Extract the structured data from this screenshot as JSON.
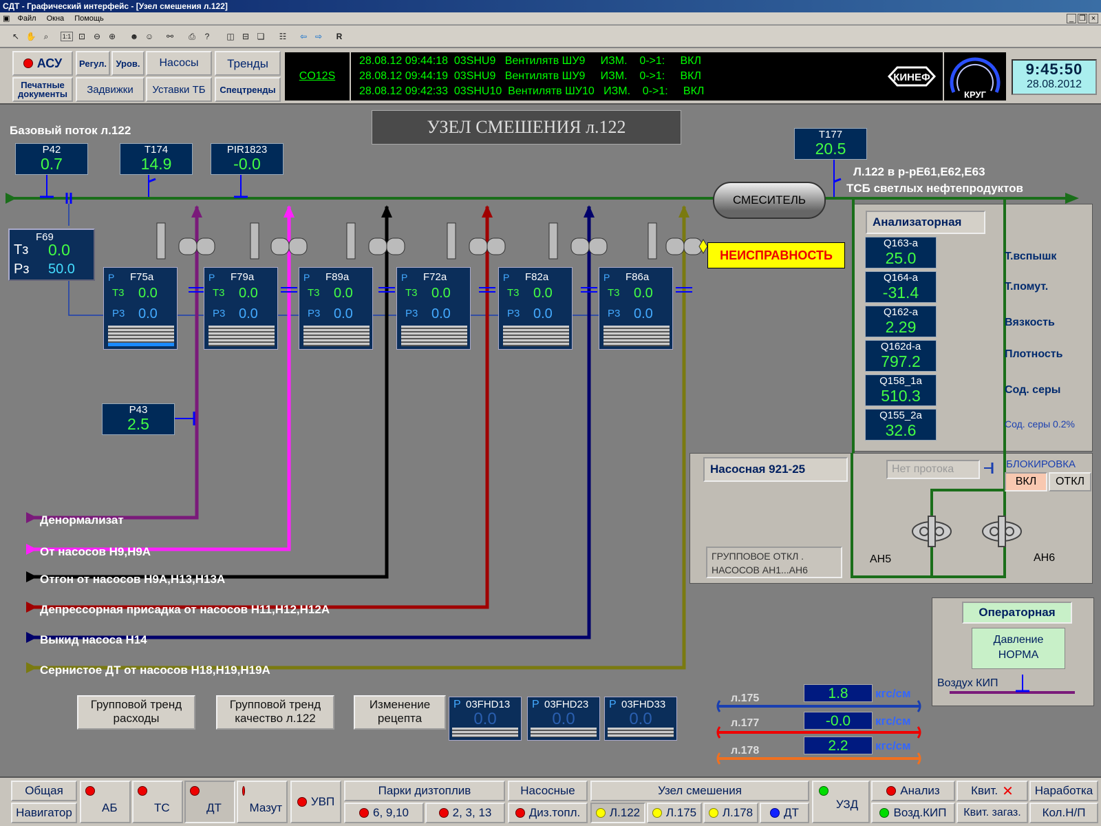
{
  "window": {
    "title": "СДТ - Графический интерфейс - [Узел смешения л.122]",
    "menu": [
      "Файл",
      "Окна",
      "Помощь"
    ],
    "toolbar_r": "R",
    "toolbar_11": "1:1"
  },
  "nav": {
    "asu": "АСУ",
    "regul": "Регул.",
    "urov": "Уров.",
    "nasosy": "Насосы",
    "trendy": "Тренды",
    "print1": "Печатные",
    "print2": "документы",
    "zadvizhki": "Задвижки",
    "ustavki": "Уставки ТБ",
    "spectrendy": "Спецтренды"
  },
  "co": "CO12S",
  "events": [
    "28.08.12 09:44:18  03SHU9   Вентилятв ШУ9     ИЗМ.    0->1:     ВКЛ",
    "28.08.12 09:44:19  03SHU9   Вентилятв ШУ9     ИЗМ.    0->1:     ВКЛ",
    "28.08.12 09:42:33  03SHU10  Вентилятв ШУ10   ИЗМ.    0->1:     ВКЛ"
  ],
  "logo": "КИНЕФ",
  "krug": "КРУГ",
  "clock": {
    "time": "9:45:50",
    "date": "28.08.2012"
  },
  "page_title": "УЗЕЛ СМЕШЕНИЯ л.122",
  "base_flow": "Базовый поток л.122",
  "sensors": {
    "p42": {
      "name": "P42",
      "value": "0.7"
    },
    "t174": {
      "name": "T174",
      "value": "14.9"
    },
    "pir1823": {
      "name": "PIR1823",
      "value": "-0.0"
    },
    "t177": {
      "name": "T177",
      "value": "20.5"
    },
    "p43": {
      "name": "P43",
      "value": "2.5"
    }
  },
  "f69": {
    "name": "F69",
    "tz_label": "Тз",
    "tz": "0.0",
    "rz_label": "Рз",
    "rz": "50.0"
  },
  "mixer": "СМЕСИТЕЛЬ",
  "dest1": "Л.122 в р-рЕ61,Е62,Е63",
  "dest2": "ТСБ светлых нефтепродуктов",
  "fault": "НЕИСПРАВНОСТЬ",
  "controllers": [
    {
      "p": "P",
      "name": "F75a",
      "tz": "Т3",
      "tv": "0.0",
      "rz": "Р3",
      "rv": "0.0"
    },
    {
      "p": "P",
      "name": "F79a",
      "tz": "Т3",
      "tv": "0.0",
      "rz": "Р3",
      "rv": "0.0"
    },
    {
      "p": "P",
      "name": "F89a",
      "tz": "Т3",
      "tv": "0.0",
      "rz": "Р3",
      "rv": "0.0"
    },
    {
      "p": "P",
      "name": "F72a",
      "tz": "Т3",
      "tv": "0.0",
      "rz": "Р3",
      "rv": "0.0"
    },
    {
      "p": "P",
      "name": "F82a",
      "tz": "Т3",
      "tv": "0.0",
      "rz": "Р3",
      "rv": "0.0"
    },
    {
      "p": "P",
      "name": "F86a",
      "tz": "Т3",
      "tv": "0.0",
      "rz": "Р3",
      "rv": "0.0"
    }
  ],
  "streams": [
    "Денормализат",
    "От насосов Н9,Н9А",
    "Отгон от насосов Н9А,Н13,Н13А",
    "Депрессорная присадка от насосов Н11,Н12,Н12А",
    "Выкид насоса Н14",
    "Сернистое ДТ от насосов Н18,Н19,Н19А"
  ],
  "stream_colors": [
    "#7a1a7a",
    "#ff20ff",
    "#000000",
    "#a00000",
    "#00006a",
    "#7a7a10"
  ],
  "analyzer": {
    "title": "Анализаторная",
    "items": [
      {
        "name": "Q163-a",
        "value": "25.0",
        "label": "Т.вспышк"
      },
      {
        "name": "Q164-a",
        "value": "-31.4",
        "label": "Т.помут."
      },
      {
        "name": "Q162-a",
        "value": "2.29",
        "label": "Вязкость"
      },
      {
        "name": "Q162d-a",
        "value": "797.2",
        "label": "Плотность"
      },
      {
        "name": "Q158_1a",
        "value": "510.3",
        "label": "Сод. серы"
      },
      {
        "name": "Q155_2a",
        "value": "32.6",
        "label": "Сод. серы 0.2%"
      }
    ]
  },
  "pumphouse": {
    "title": "Насосная 921-25",
    "noflow": "Нет протока",
    "block": "БЛОКИРОВКА",
    "on": "ВКЛ",
    "off": "ОТКЛ",
    "group1": "ГРУППОВОЕ ОТКЛ .",
    "group2": "НАСОСОВ АН1...АН6",
    "ah5": "АН5",
    "ah6": "АН6"
  },
  "operator": {
    "title": "Операторная",
    "pressure1": "Давление",
    "pressure2": "НОРМА",
    "air": "Воздух КИП"
  },
  "buttons": {
    "trend1a": "Групповой тренд",
    "trend1b": "расходы",
    "trend2a": "Групповой тренд",
    "trend2b": "качество л.122",
    "recipe1": "Изменение",
    "recipe2": "рецепта"
  },
  "fhd": [
    {
      "p": "P",
      "name": "03FHD13",
      "value": "0.0"
    },
    {
      "p": "P",
      "name": "03FHD23",
      "value": "0.0"
    },
    {
      "p": "P",
      "name": "03FHD33",
      "value": "0.0"
    }
  ],
  "lines": [
    {
      "name": "л.175",
      "value": "1.8",
      "unit": "кгс/см"
    },
    {
      "name": "л.177",
      "value": "-0.0",
      "unit": "кгс/см"
    },
    {
      "name": "л.178",
      "value": "2.2",
      "unit": "кгс/см"
    }
  ],
  "footer": {
    "obshaya": "Общая",
    "navigator": "Навигатор",
    "ab": "АБ",
    "ts": "ТС",
    "dt": "ДТ",
    "mazut": "Мазут",
    "uvp": "УВП",
    "parki": "Парки дизтоплив",
    "p6910": "6, 9,10",
    "p2313": "2, 3, 13",
    "nasosnye": "Насосные",
    "diz": "Диз.топл.",
    "uzel": "Узел смешения",
    "l122": "Л.122",
    "l175": "Л.175",
    "l178": "Л.178",
    "dt2": "ДТ",
    "uzd": "УЗД",
    "analiz": "Анализ",
    "vozd": "Возд.КИП",
    "kvit": "Квит.",
    "kvitzag": "Квит. загаз.",
    "naraboтka": "Наработка",
    "koln": "Кол.Н/П"
  }
}
